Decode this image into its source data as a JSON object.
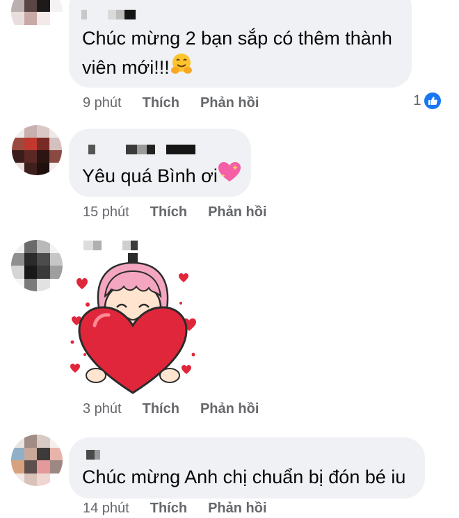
{
  "comments": [
    {
      "text_line1": "Chúc mừng 2 bạn sắp có thêm thành",
      "text_line2": "viên mới!!!",
      "emoji": "hugging-face",
      "time": "9 phút",
      "like_label": "Thích",
      "reply_label": "Phản hồi",
      "reaction_count": "1",
      "reaction_icon": "thumbs-up-icon"
    },
    {
      "text": "Yêu quá Bình ơi",
      "emoji": "sparkling-heart",
      "time": "15 phút",
      "like_label": "Thích",
      "reply_label": "Phản hồi"
    },
    {
      "sticker": "girl-hugging-heart-sticker",
      "time": "3 phút",
      "like_label": "Thích",
      "reply_label": "Phản hồi"
    },
    {
      "text": "Chúc mừng Anh chị chuẩn bị đón bé iu",
      "time": "14 phút",
      "like_label": "Thích",
      "reply_label": "Phản hồi"
    }
  ],
  "colors": {
    "bubble": "#eff1f4",
    "meta_text": "#65676b",
    "like_blue": "#1877f2",
    "heart_red": "#e0263a",
    "hair_pink": "#f4a6c0"
  }
}
